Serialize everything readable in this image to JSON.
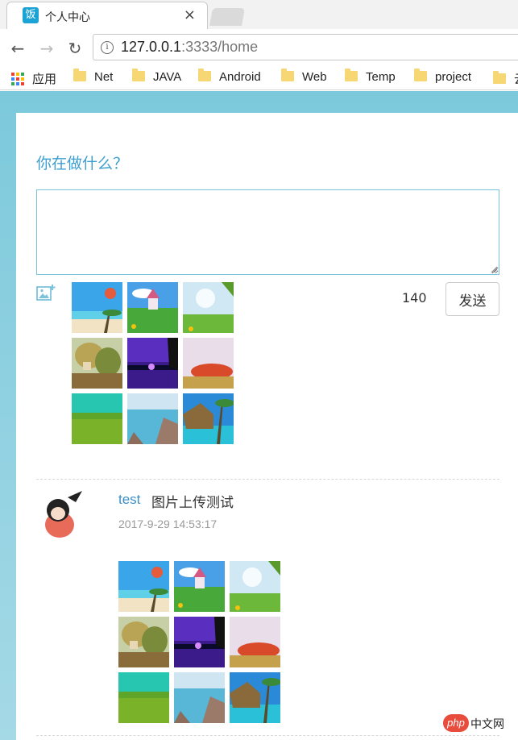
{
  "browser": {
    "tab": {
      "favicon_text": "饭",
      "title": "个人中心",
      "close": "×"
    },
    "address": {
      "host": "127.0.0.1",
      "rest": ":3333/home"
    },
    "bookmarks": [
      {
        "label": "应用",
        "icon": "apps-grid-icon"
      },
      {
        "label": "Net",
        "icon": "folder-icon"
      },
      {
        "label": "JAVA",
        "icon": "folder-icon"
      },
      {
        "label": "Android",
        "icon": "folder-icon"
      },
      {
        "label": "Web",
        "icon": "folder-icon"
      },
      {
        "label": "Temp",
        "icon": "folder-icon"
      },
      {
        "label": "project",
        "icon": "folder-icon"
      },
      {
        "label": "云",
        "icon": "folder-icon"
      }
    ]
  },
  "composer": {
    "prompt": "你在做什么？",
    "text_value": "",
    "char_count": "140",
    "send_label": "发送",
    "images": [
      "beach-balloon",
      "castle-meadow",
      "sky-meadow",
      "autumn-forest",
      "purple-night-lake",
      "desert-sunset",
      "green-field",
      "rocky-coast",
      "palm-hut"
    ]
  },
  "post": {
    "user": "test",
    "text": "图片上传测试",
    "time": "2017-9-29 14:53:17",
    "images": [
      "beach-balloon",
      "castle-meadow",
      "sky-meadow",
      "autumn-forest",
      "purple-night-lake",
      "desert-sunset",
      "green-field",
      "rocky-coast",
      "palm-hut"
    ]
  },
  "watermark": {
    "logo": "php",
    "text": "中文网"
  },
  "colors": {
    "accent": "#3d9fd1",
    "page_bg": "#7cc9dc",
    "link": "#3d8fc6"
  }
}
